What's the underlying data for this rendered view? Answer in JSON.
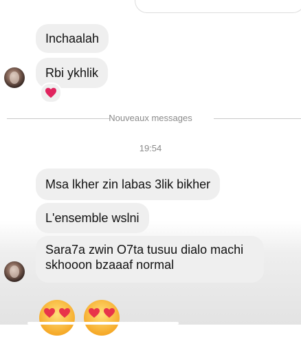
{
  "messages": {
    "m1": "Inchaalah",
    "m2": "Rbi ykhlik",
    "m3": "Msa lkher zin labas 3lik bikher",
    "m4": "L'ensemble wslni",
    "m5": "Sara7a zwin O7ta tusuu dialo machi skhooon bzaaaf normal"
  },
  "divider": {
    "label": "Nouveaux messages"
  },
  "timestamp": "19:54",
  "reaction": {
    "icon": "red-heart-icon",
    "color": "#e0245e"
  },
  "emojis": [
    "heart-eyes-emoji-icon",
    "heart-eyes-emoji-icon"
  ]
}
